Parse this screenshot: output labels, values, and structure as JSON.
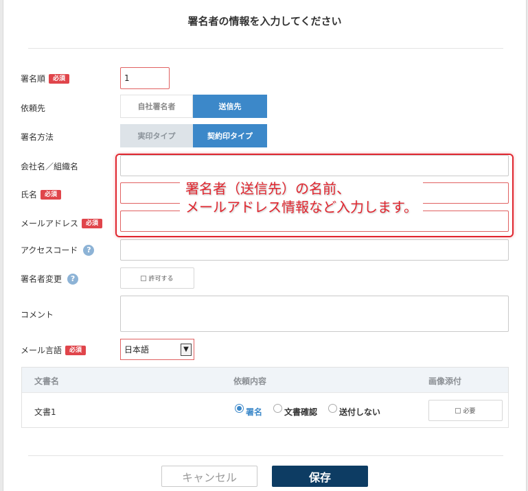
{
  "dialog": {
    "title": "署名者の情報を入力してください"
  },
  "badges": {
    "required": "必須",
    "help": "?"
  },
  "form": {
    "sign_order": {
      "label": "署名順",
      "value": "1"
    },
    "request_to": {
      "label": "依頼先",
      "options": [
        "自社署名者",
        "送信先"
      ],
      "selected": "送信先"
    },
    "sign_method": {
      "label": "署名方法",
      "options": [
        "実印タイプ",
        "契約印タイプ"
      ],
      "selected": "契約印タイプ"
    },
    "company": {
      "label": "会社名／組織名",
      "value": ""
    },
    "name": {
      "label": "氏名",
      "value": ""
    },
    "email": {
      "label": "メールアドレス",
      "value": ""
    },
    "access_code": {
      "label": "アクセスコード",
      "value": ""
    },
    "signer_change": {
      "label": "署名者変更",
      "checkbox_label": "許可する",
      "checked": false
    },
    "comment": {
      "label": "コメント",
      "value": ""
    },
    "mail_language": {
      "label": "メール言語",
      "selected": "日本語"
    }
  },
  "documents": {
    "headers": [
      "文書名",
      "依頼内容",
      "画像添付"
    ],
    "rows": [
      {
        "name": "文書1",
        "options": [
          "署名",
          "文書確認",
          "送付しない"
        ],
        "selected": "署名",
        "attach_label": "必要",
        "attach_checked": false
      }
    ]
  },
  "annotation": {
    "text": "署名者（送信先）の名前、\nメールアドレス情報など入力します。",
    "color": "#e0262f"
  },
  "footer": {
    "cancel_label": "キャンセル",
    "save_label": "保存"
  },
  "colors": {
    "accent": "#3c88c9",
    "required": "#e0454b",
    "save": "#0d3c63"
  }
}
